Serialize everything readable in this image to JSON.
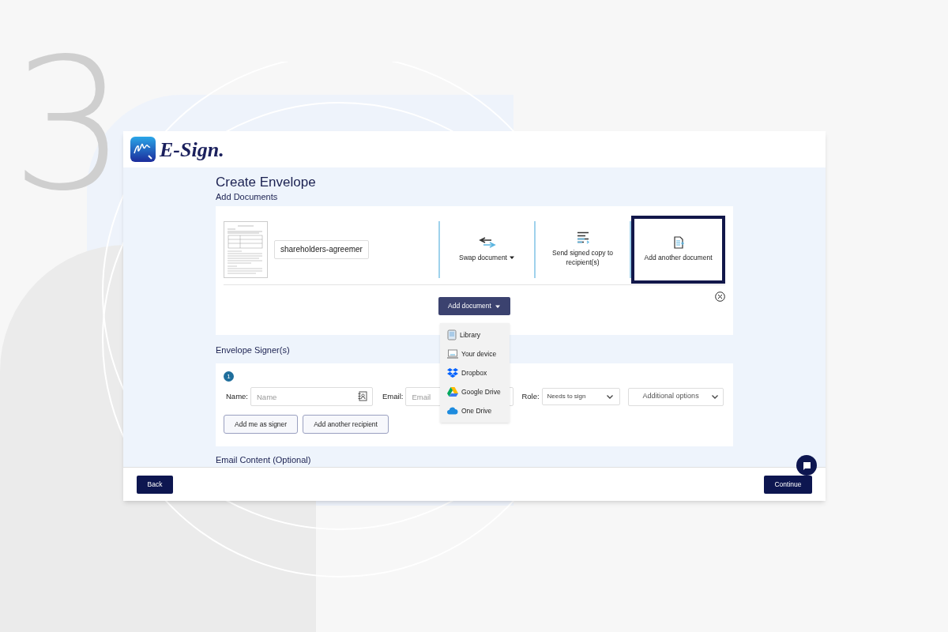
{
  "step_number": "3",
  "logo": {
    "text": "E-Sign."
  },
  "page": {
    "title": "Create Envelope",
    "subtitle": "Add Documents"
  },
  "document": {
    "filename": "shareholders-agreemer",
    "actions": [
      {
        "kind": "swap",
        "label": "Swap document",
        "has_caret": true,
        "selected": false
      },
      {
        "kind": "send",
        "label": "Send signed copy to recipient(s)",
        "has_caret": false,
        "selected": false
      },
      {
        "kind": "add",
        "label": "Add another document",
        "has_caret": false,
        "selected": true
      }
    ],
    "add_button": "Add document",
    "menu": [
      {
        "kind": "library",
        "label": "Library"
      },
      {
        "kind": "device",
        "label": "Your device"
      },
      {
        "kind": "dropbox",
        "label": "Dropbox"
      },
      {
        "kind": "gdrive",
        "label": "Google Drive"
      },
      {
        "kind": "onedrive",
        "label": "One Drive"
      }
    ]
  },
  "signers": {
    "heading": "Envelope Signer(s)",
    "number": "1",
    "name_label": "Name:",
    "name_placeholder": "Name",
    "email_label": "Email:",
    "email_placeholder": "Email",
    "role_label": "Role:",
    "role_value": "Needs to sign",
    "options_value": "Additional options",
    "buttons": [
      "Add me as signer",
      "Add another recipient"
    ]
  },
  "email_heading": "Email Content (Optional)",
  "footer": {
    "back": "Back",
    "continue": "Continue"
  }
}
